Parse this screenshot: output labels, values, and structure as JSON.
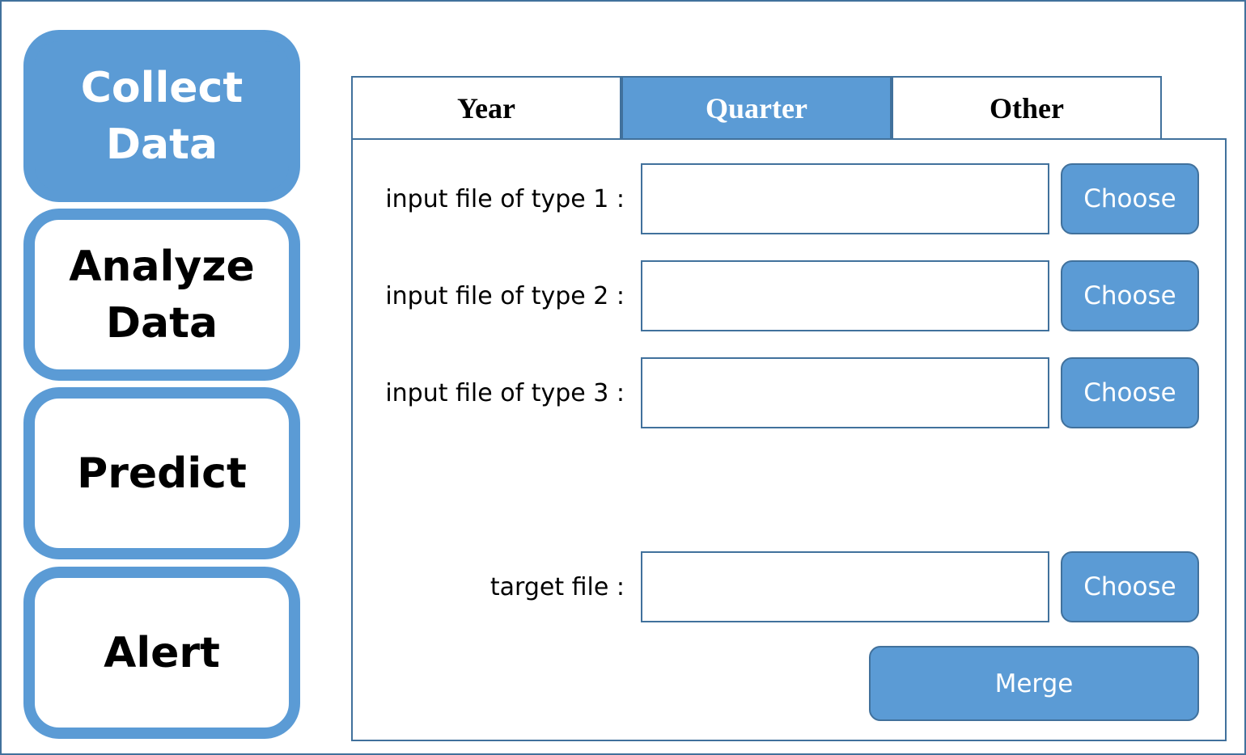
{
  "sidebar": {
    "items": [
      {
        "label": "Collect\nData",
        "active": true
      },
      {
        "label": "Analyze\nData",
        "active": false
      },
      {
        "label": "Predict",
        "active": false
      },
      {
        "label": "Alert",
        "active": false
      }
    ]
  },
  "tabs": [
    {
      "label": "Year",
      "active": false
    },
    {
      "label": "Quarter",
      "active": true
    },
    {
      "label": "Other",
      "active": false
    }
  ],
  "form": {
    "rows": [
      {
        "label": "input file of type 1 :",
        "value": "",
        "button": "Choose"
      },
      {
        "label": "input file of type 2 :",
        "value": "",
        "button": "Choose"
      },
      {
        "label": "input file of type 3 :",
        "value": "",
        "button": "Choose"
      },
      {
        "label": "target file :",
        "value": "",
        "button": "Choose"
      }
    ],
    "merge_label": "Merge"
  },
  "colors": {
    "accent": "#5b9bd5",
    "border": "#41719c",
    "background": "#ffffff",
    "text": "#000000"
  }
}
